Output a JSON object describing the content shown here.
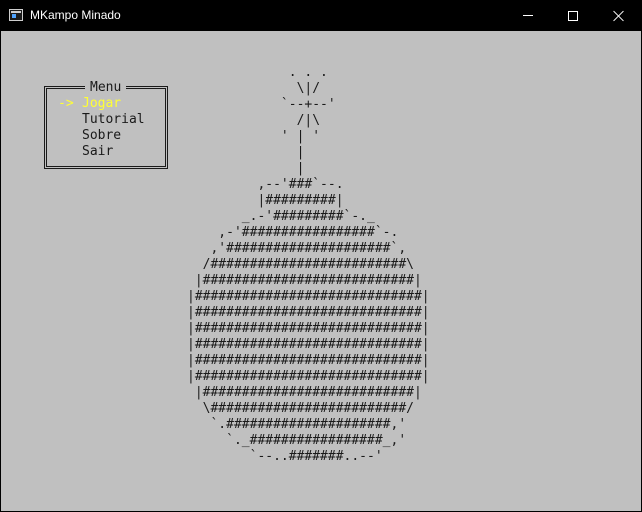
{
  "window": {
    "title": "MKampo Minado"
  },
  "menu": {
    "title": "Menu",
    "cursor": "->",
    "selected_index": 0,
    "items": [
      {
        "label": "Jogar"
      },
      {
        "label": "Tutorial"
      },
      {
        "label": "Sobre"
      },
      {
        "label": "Sair"
      }
    ]
  },
  "ascii_art": {
    "lines": [
      "             . . .",
      "              \\|/",
      "            `--+--'",
      "              /|\\",
      "            ' | '",
      "              |",
      "              |",
      "         ,--'###`--.",
      "         |#########|",
      "       _.-'#########`-._",
      "    ,-'#################`-.",
      "   ,'#####################`,",
      "  /#########################\\",
      " |###########################|",
      "|#############################|",
      "|#############################|",
      "|#############################|",
      "|#############################|",
      "|#############################|",
      "|#############################|",
      " |###########################|",
      "  \\#########################/",
      "   `.#####################,'",
      "     `._#################_,'",
      "        `--..#######..--'"
    ]
  },
  "colors": {
    "console_bg": "#c0c0c0",
    "text": "#1a1a1a",
    "selected": "#ffff33",
    "titlebar": "#000000"
  }
}
